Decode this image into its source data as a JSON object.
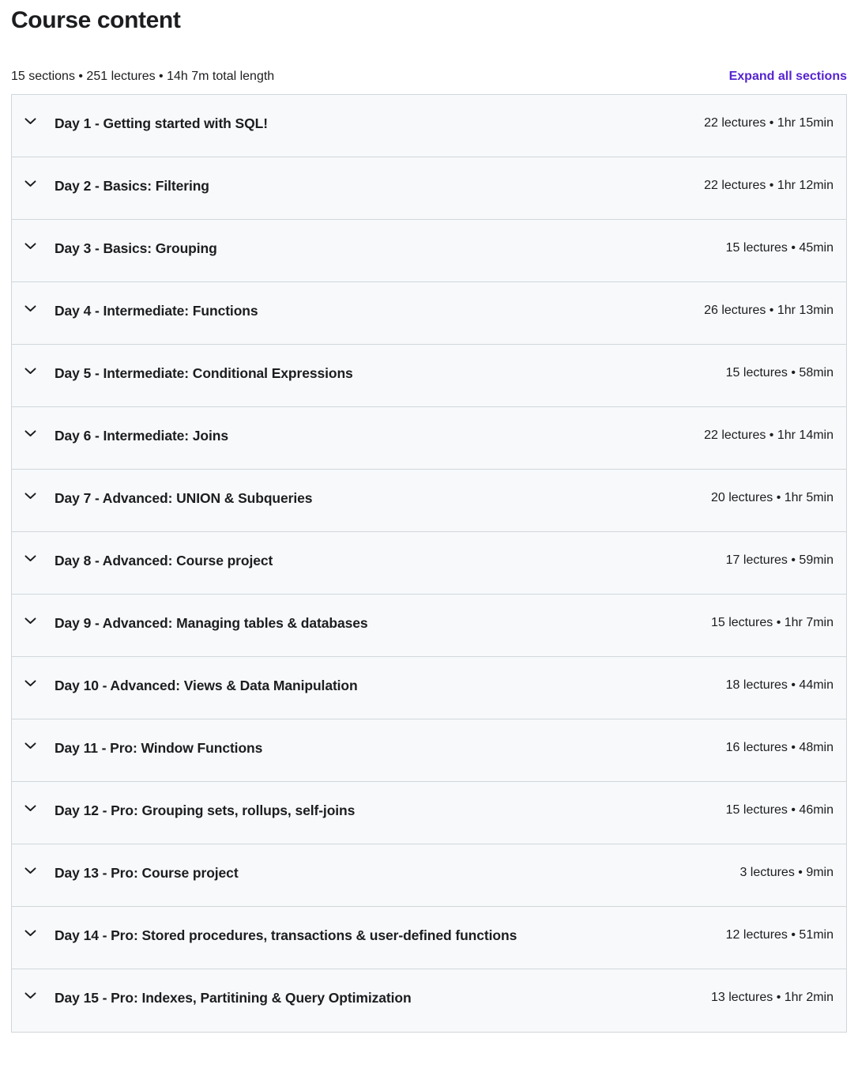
{
  "header": {
    "title": "Course content",
    "summary": "15 sections • 251 lectures • 14h 7m total length",
    "expand_all_label": "Expand all sections",
    "accent_color": "#5624d0"
  },
  "counts": {
    "sections": 15,
    "lectures": 251,
    "total_length": "14h 7m"
  },
  "sections": [
    {
      "title": "Day 1 - Getting started with SQL!",
      "meta": "22 lectures • 1hr 15min",
      "lectures": 22,
      "duration": "1hr 15min",
      "expanded": false
    },
    {
      "title": "Day 2 - Basics: Filtering",
      "meta": "22 lectures • 1hr 12min",
      "lectures": 22,
      "duration": "1hr 12min",
      "expanded": false
    },
    {
      "title": "Day 3 - Basics: Grouping",
      "meta": "15 lectures • 45min",
      "lectures": 15,
      "duration": "45min",
      "expanded": false
    },
    {
      "title": "Day 4 - Intermediate: Functions",
      "meta": "26 lectures • 1hr 13min",
      "lectures": 26,
      "duration": "1hr 13min",
      "expanded": false
    },
    {
      "title": "Day 5 - Intermediate: Conditional Expressions",
      "meta": "15 lectures • 58min",
      "lectures": 15,
      "duration": "58min",
      "expanded": false
    },
    {
      "title": "Day 6 - Intermediate: Joins",
      "meta": "22 lectures • 1hr 14min",
      "lectures": 22,
      "duration": "1hr 14min",
      "expanded": false
    },
    {
      "title": "Day 7 - Advanced: UNION & Subqueries",
      "meta": "20 lectures • 1hr 5min",
      "lectures": 20,
      "duration": "1hr 5min",
      "expanded": false
    },
    {
      "title": "Day 8 - Advanced: Course project",
      "meta": "17 lectures • 59min",
      "lectures": 17,
      "duration": "59min",
      "expanded": false
    },
    {
      "title": "Day 9 - Advanced: Managing tables & databases",
      "meta": "15 lectures • 1hr 7min",
      "lectures": 15,
      "duration": "1hr 7min",
      "expanded": false
    },
    {
      "title": "Day 10 - Advanced: Views & Data Manipulation",
      "meta": "18 lectures • 44min",
      "lectures": 18,
      "duration": "44min",
      "expanded": false
    },
    {
      "title": "Day 11 - Pro: Window Functions",
      "meta": "16 lectures • 48min",
      "lectures": 16,
      "duration": "48min",
      "expanded": false
    },
    {
      "title": "Day 12 - Pro: Grouping sets, rollups, self-joins",
      "meta": "15 lectures • 46min",
      "lectures": 15,
      "duration": "46min",
      "expanded": false
    },
    {
      "title": "Day 13 - Pro: Course project",
      "meta": "3 lectures • 9min",
      "lectures": 3,
      "duration": "9min",
      "expanded": false
    },
    {
      "title": "Day 14 - Pro: Stored procedures, transactions & user-defined functions",
      "meta": "12 lectures • 51min",
      "lectures": 12,
      "duration": "51min",
      "expanded": false
    },
    {
      "title": "Day 15 - Pro: Indexes, Partitining & Query Optimization",
      "meta": "13 lectures • 1hr 2min",
      "lectures": 13,
      "duration": "1hr 2min",
      "expanded": false
    }
  ],
  "icons": {
    "chevron": "chevron-down-icon"
  }
}
